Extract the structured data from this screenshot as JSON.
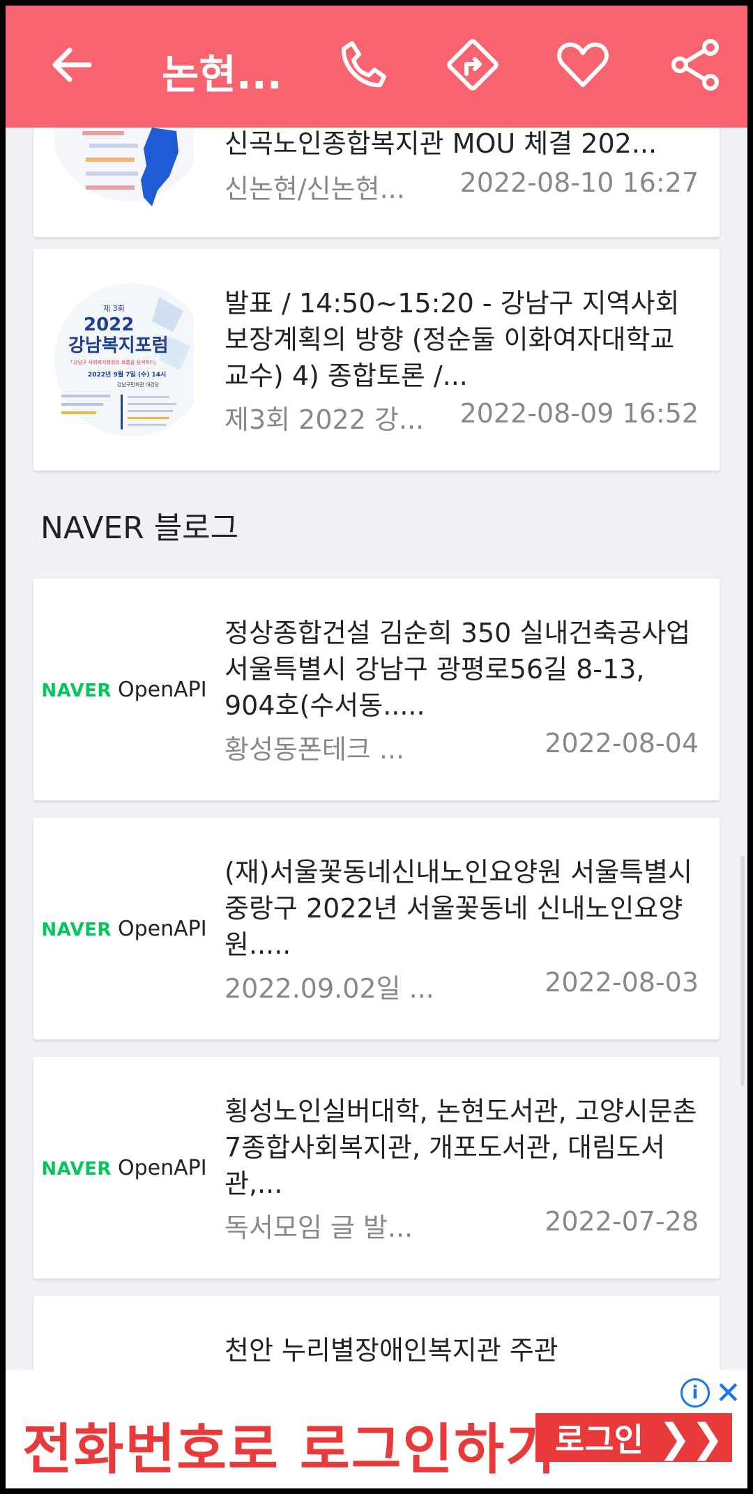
{
  "header": {
    "title": "논현...",
    "icons": [
      "back-arrow-icon",
      "phone-icon",
      "directions-icon",
      "heart-icon",
      "share-icon"
    ]
  },
  "cards_top": [
    {
      "title": "신곡노인종합복지관 MOU 체결 202...",
      "source": "신논현/신논현...",
      "date": "2022-08-10 16:27"
    },
    {
      "title": "발표 / 14:50~15:20 - 강남구 지역사회보장계획의 방향 (정순둘 이화여자대학교 교수) 4) 종합토론 /...",
      "source": "제3회 2022 강...",
      "date": "2022-08-09 16:52",
      "thumb": {
        "top": "제 3회",
        "year": "2022",
        "name": "강남복지포럼",
        "tagline": "「강남구 사회복지행정의 흐름을 탐색하다」",
        "when": "2022년 9월 7일 (수) 14시",
        "where": "강남구민회관 대강당"
      }
    }
  ],
  "section": {
    "title": "NAVER 블로그"
  },
  "blog_cards": [
    {
      "title": "정상종합건설 김순희 350 실내건축공사업 서울특별시 강남구 광평로56길 8-13, 904호(수서동.....",
      "source": "황성동폰테크 ...",
      "date": "2022-08-04"
    },
    {
      "title": "(재)서울꽃동네신내노인요양원 서울특별시 중랑구 2022년 서울꽃동네 신내노인요양원.....",
      "source": "2022.09.02일 ...",
      "date": "2022-08-03"
    },
    {
      "title": "횡성노인실버대학, 논현도서관, 고양시문촌7종합사회복지관, 개포도서관, 대림도서관,...",
      "source": "독서모임 글 발...",
      "date": "2022-07-28"
    },
    {
      "title": "천안 누리별장애인복지관 주관"
    }
  ],
  "naver_logo": {
    "brand": "NAVER",
    "product": "OpenAPI"
  },
  "ad": {
    "text": "전화번호로 로그인하기",
    "button": "로그인",
    "arrow": "❯❯",
    "info": "i",
    "close": "✕"
  },
  "colors": {
    "header": "#f7636e",
    "background": "#eff1f5",
    "naver_green": "#03c75a",
    "ad_red": "#e83a3a"
  }
}
